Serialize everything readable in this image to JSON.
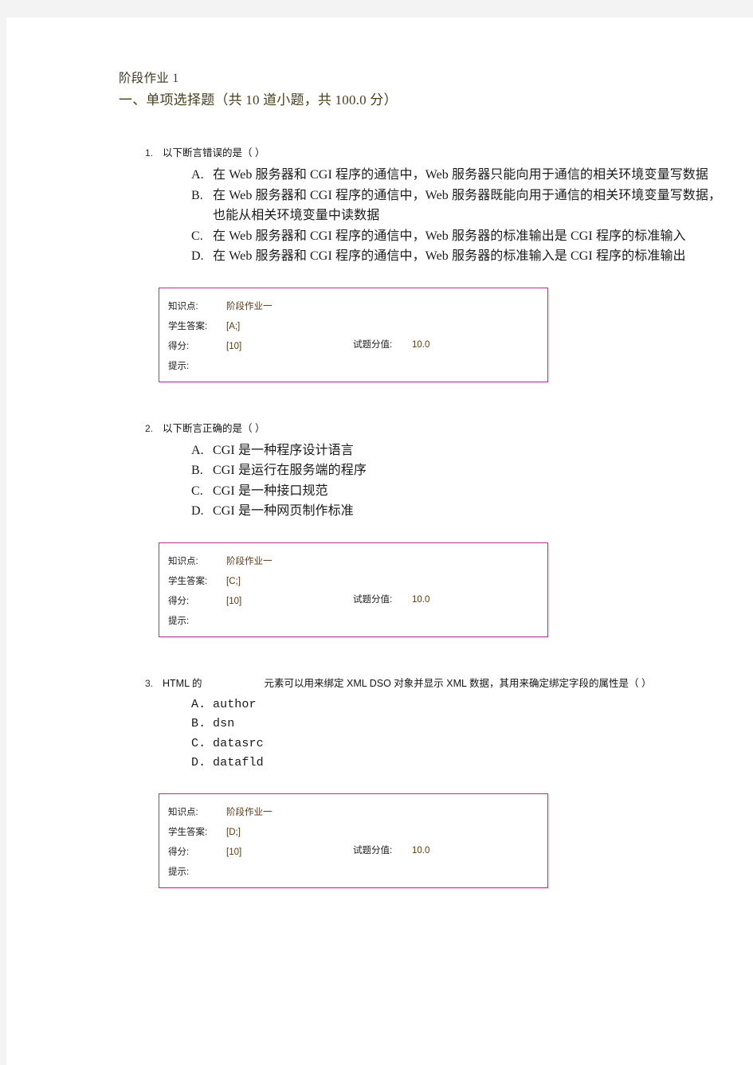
{
  "header": {
    "doc_title": "阶段作业 1",
    "section_title": "一、单项选择题（共 10 道小题，共 100.0 分）"
  },
  "answer_box_labels": {
    "knowledge_point": "知识点:",
    "student_answer": "学生答案:",
    "score": "得分:",
    "question_value": "试题分值:",
    "hint": "提示:"
  },
  "questions": [
    {
      "number": "1.",
      "stem": "以下断言错误的是（ ）",
      "stem_gap": false,
      "stem_tail": "",
      "mono_options": false,
      "options": [
        {
          "letter": "A.",
          "text": "在 Web 服务器和 CGI 程序的通信中，Web 服务器只能向用于通信的相关环境变量写数据"
        },
        {
          "letter": "B.",
          "text": "在 Web 服务器和 CGI 程序的通信中，Web 服务器既能向用于通信的相关环境变量写数据，也能从相关环境变量中读数据"
        },
        {
          "letter": "C.",
          "text": "在 Web 服务器和 CGI 程序的通信中，Web 服务器的标准输出是 CGI 程序的标准输入"
        },
        {
          "letter": "D.",
          "text": "在 Web 服务器和 CGI 程序的通信中，Web 服务器的标准输入是 CGI 程序的标准输出"
        }
      ],
      "answer_box": {
        "knowledge_point": "阶段作业一",
        "student_answer": "[A;]",
        "score": "[10]",
        "question_value": "10.0",
        "hint": ""
      }
    },
    {
      "number": "2.",
      "stem": "以下断言正确的是（ ）",
      "stem_gap": false,
      "stem_tail": "",
      "mono_options": false,
      "options": [
        {
          "letter": "A.",
          "text": "CGI 是一种程序设计语言"
        },
        {
          "letter": "B.",
          "text": "CGI 是运行在服务端的程序"
        },
        {
          "letter": "C.",
          "text": "CGI 是一种接口规范"
        },
        {
          "letter": "D.",
          "text": "CGI 是一种网页制作标准"
        }
      ],
      "answer_box": {
        "knowledge_point": "阶段作业一",
        "student_answer": "[C;]",
        "score": "[10]",
        "question_value": "10.0",
        "hint": ""
      }
    },
    {
      "number": "3.",
      "stem": "HTML 的",
      "stem_gap": true,
      "stem_tail": "元素可以用来绑定 XML DSO 对象并显示 XML 数据，其用来确定绑定字段的属性是（ ）",
      "mono_options": true,
      "options": [
        {
          "letter": "A.",
          "text": "author"
        },
        {
          "letter": "B.",
          "text": "dsn"
        },
        {
          "letter": "C.",
          "text": "datasrc"
        },
        {
          "letter": "D.",
          "text": "datafld"
        }
      ],
      "answer_box": {
        "knowledge_point": "阶段作业一",
        "student_answer": "[D;]",
        "score": "[10]",
        "question_value": "10.0",
        "hint": ""
      }
    }
  ]
}
